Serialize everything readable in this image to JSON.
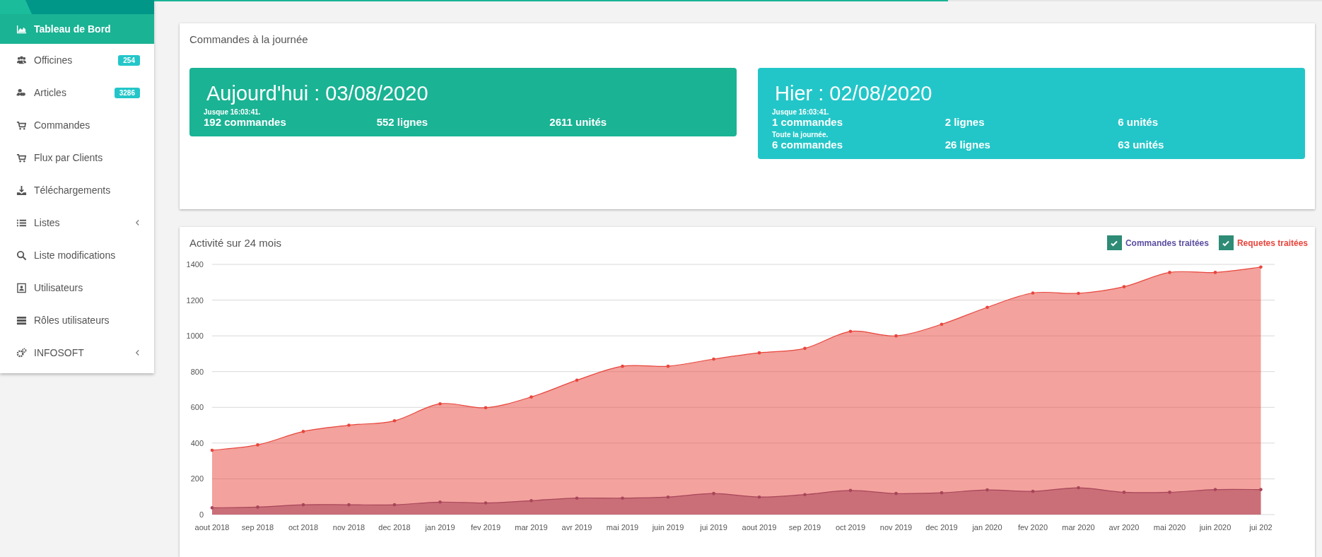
{
  "sidebar": {
    "items": [
      {
        "label": "Tableau de Bord",
        "selected": true
      },
      {
        "label": "Officines",
        "selected": false,
        "badge": "254"
      },
      {
        "label": "Articles",
        "selected": false,
        "badge": "3286"
      },
      {
        "label": "Commandes",
        "selected": false
      },
      {
        "label": "Flux par Clients",
        "selected": false
      },
      {
        "label": "Téléchargements",
        "selected": false
      },
      {
        "label": "Listes",
        "selected": false,
        "expanded": false
      },
      {
        "label": "Liste modifications",
        "selected": false
      },
      {
        "label": "Utilisateurs",
        "selected": false
      },
      {
        "label": "Rôles utilisateurs",
        "selected": false
      },
      {
        "label": "INFOSOFT",
        "selected": false,
        "expanded": false
      }
    ]
  },
  "loading_bar": {
    "level": 0.68
  },
  "daily_card": {
    "title": "Commandes à la journée",
    "days": [
      {
        "kind": "today",
        "title": "Aujourd'hui : 03/08/2020",
        "groups": [
          {
            "caption": "Jusque 16:03:41.",
            "values": [
              "192 commandes",
              "552 lignes",
              "2611 unités"
            ]
          }
        ]
      },
      {
        "kind": "yesterday",
        "title": "Hier : 02/08/2020",
        "groups": [
          {
            "caption": "Jusque 16:03:41.",
            "values": [
              "1 commandes",
              "2 lignes",
              "6 unités"
            ]
          },
          {
            "caption": "Toute la journée.",
            "values": [
              "6 commandes",
              "26 lignes",
              "63 unités"
            ]
          }
        ]
      }
    ]
  },
  "activity_card": {
    "title": "Activité sur 24 mois",
    "legend": [
      {
        "checked": true,
        "color": "#5b4fa0"
      },
      {
        "checked": true,
        "color": "#e8453c"
      }
    ],
    "chart_data": {
      "type": "area",
      "categories": [
        "aout 2018",
        "sep 2018",
        "oct 2018",
        "nov 2018",
        "dec 2018",
        "jan 2019",
        "fev 2019",
        "mar 2019",
        "avr 2019",
        "mai 2019",
        "juin 2019",
        "jui 2019",
        "aout 2019",
        "sep 2019",
        "oct 2019",
        "nov 2019",
        "dec 2019",
        "jan 2020",
        "fev 2020",
        "mar 2020",
        "avr 2020",
        "mai 2020",
        "juin 2020",
        "jui 202"
      ],
      "series": [
        {
          "name": "Commandes traitées",
          "color": "#a8455a",
          "values": [
            38,
            42,
            55,
            55,
            55,
            70,
            65,
            78,
            92,
            92,
            98,
            118,
            98,
            112,
            135,
            118,
            122,
            138,
            130,
            150,
            125,
            125,
            140,
            140
          ]
        },
        {
          "name": "Requetes traitées",
          "color": "#e8453c",
          "values": [
            360,
            390,
            465,
            500,
            525,
            620,
            598,
            658,
            752,
            830,
            830,
            870,
            905,
            930,
            1025,
            1000,
            1065,
            1160,
            1240,
            1238,
            1275,
            1355,
            1355,
            1385
          ]
        }
      ],
      "ylim": [
        0,
        1400
      ],
      "yticks": [
        0,
        200,
        400,
        600,
        800,
        1000,
        1200,
        1400
      ],
      "grid": true,
      "stacked": false
    }
  }
}
